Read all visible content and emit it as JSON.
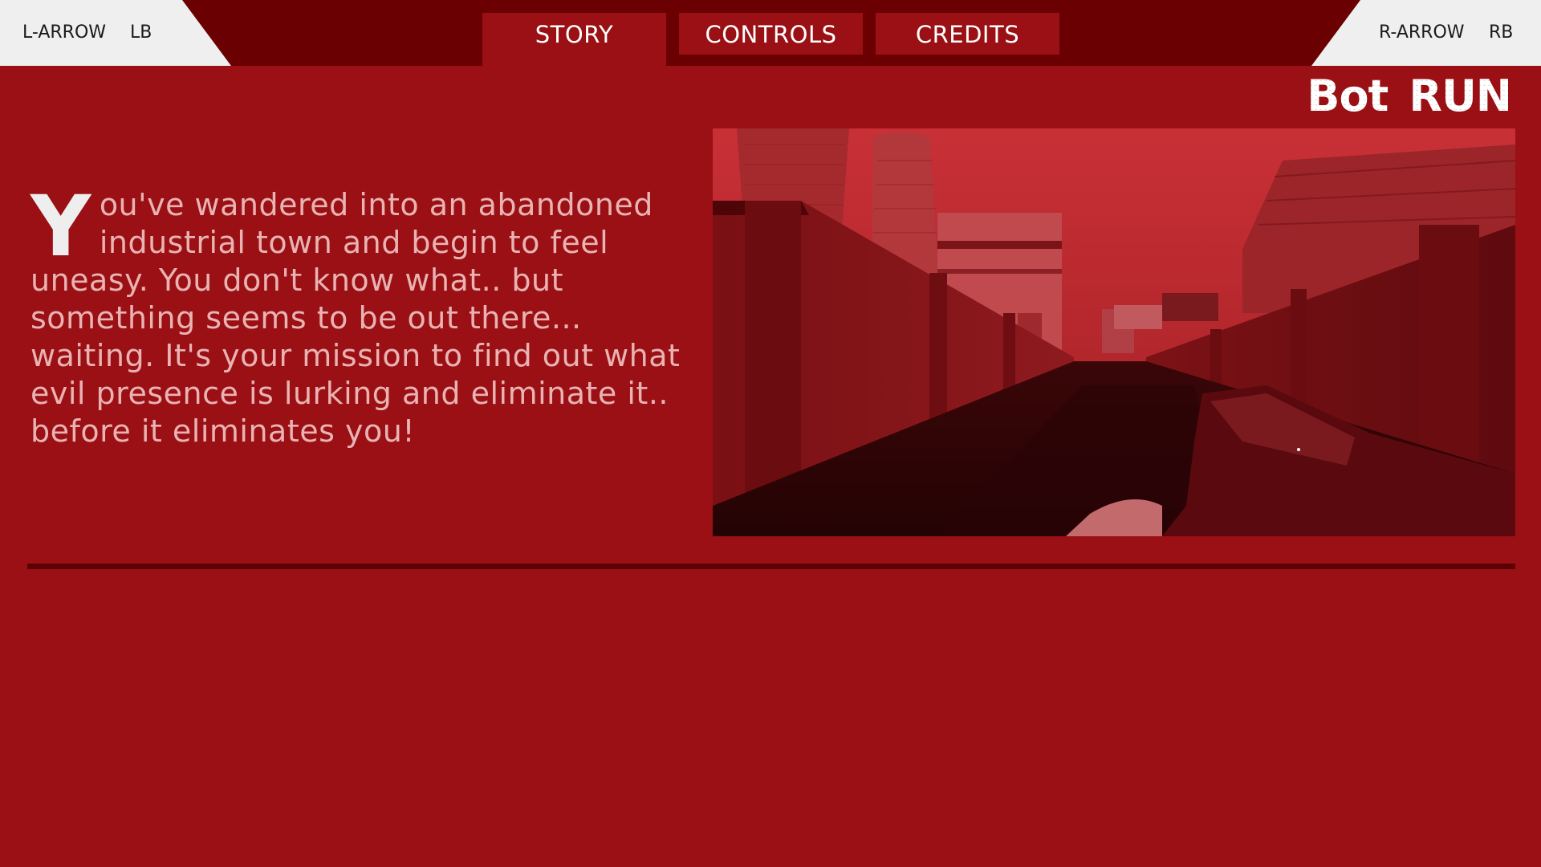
{
  "nav": {
    "left_hint": {
      "key": "L-ARROW",
      "button": "LB"
    },
    "right_hint": {
      "key": "R-ARROW",
      "button": "RB"
    },
    "tabs": [
      {
        "label": "STORY",
        "active": true
      },
      {
        "label": "CONTROLS",
        "active": false
      },
      {
        "label": "CREDITS",
        "active": false
      }
    ]
  },
  "logo": {
    "text": "Bot_RUN"
  },
  "story": {
    "dropcap": "Y",
    "text": "ou've wandered into an abandoned industrial town and begin to feel uneasy. You don't know what.. but something seems to be out there... waiting. It's your mission to find out what evil presence is lurking and eliminate it.. before it eliminates you!"
  },
  "colors": {
    "background": "#9a1014",
    "topbar": "#6a0002",
    "hint_panel": "#efefef",
    "story_text": "#e9b3b3",
    "divider": "#5c0003"
  }
}
